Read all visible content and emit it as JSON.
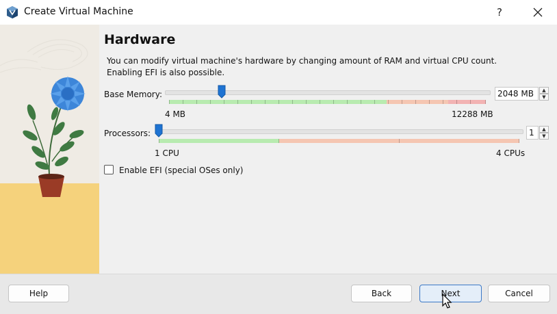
{
  "window": {
    "title": "Create Virtual Machine",
    "help_label": "?",
    "app_icon": "virtualbox-icon",
    "close_icon": "close-icon"
  },
  "page": {
    "heading": "Hardware",
    "description_line1": "You can modify virtual machine's hardware by changing amount of RAM and virtual CPU count.",
    "description_line2": "Enabling EFI is also possible."
  },
  "memory": {
    "label": "Base Memory:",
    "min_label": "4 MB",
    "max_label": "12288 MB",
    "value": "2048 MB",
    "min": 4,
    "max": 12288,
    "current": 2048,
    "unit": "MB"
  },
  "processors": {
    "label": "Processors:",
    "min_label": "1 CPU",
    "max_label": "4 CPUs",
    "value": "1",
    "min": 1,
    "max": 4,
    "current": 1
  },
  "efi": {
    "label": "Enable EFI (special OSes only)",
    "checked": false
  },
  "buttons": {
    "help": "Help",
    "back": "Back",
    "next": "Next",
    "cancel": "Cancel"
  },
  "colors": {
    "ok_zone": "#b8ebb0",
    "warn_zone": "#f5c6b2",
    "danger_zone": "#f2b3b3",
    "thumb": "#1e73d2",
    "primary_border": "#3b78c6"
  }
}
